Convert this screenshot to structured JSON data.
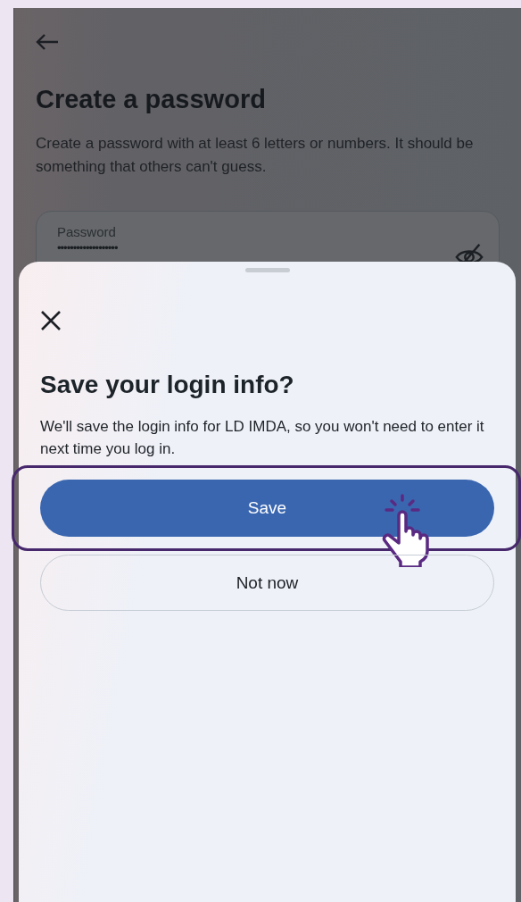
{
  "page": {
    "title": "Create a password",
    "description": "Create a password with at least 6 letters or numbers. It should be something that others can't guess.",
    "password_field": {
      "label": "Password",
      "value": "•••••••••••••••••••",
      "masked": true
    }
  },
  "sheet": {
    "title": "Save your login info?",
    "body": "We'll save the login info for  LD IMDA, so you won't need to enter it next time you log in.",
    "buttons": [
      {
        "label": "Save",
        "kind": "primary",
        "highlighted": true
      },
      {
        "label": "Not now",
        "kind": "secondary",
        "highlighted": false
      }
    ]
  }
}
